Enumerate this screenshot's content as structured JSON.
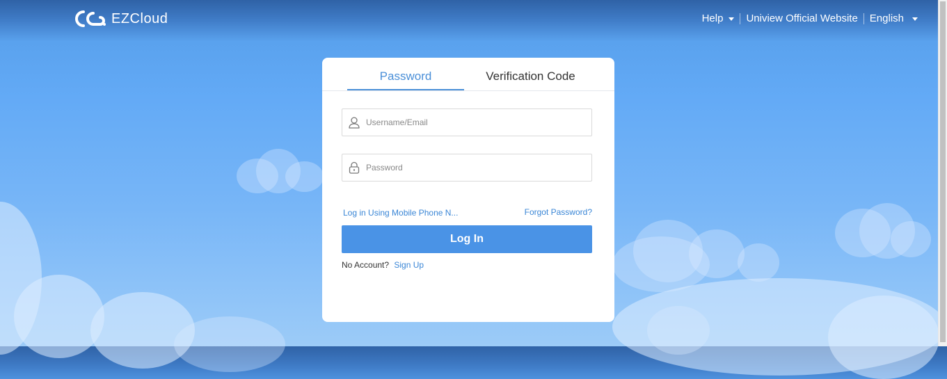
{
  "header": {
    "logo_text": "EZCloud",
    "nav": {
      "help": "Help",
      "official_site": "Uniview Official Website",
      "language": "English"
    }
  },
  "login": {
    "tabs": {
      "password": "Password",
      "verification_code": "Verification Code",
      "active": "Password"
    },
    "username": {
      "placeholder": "Username/Email",
      "value": ""
    },
    "password": {
      "placeholder": "Password",
      "value": ""
    },
    "mobile_login_link": "Log in Using Mobile Phone N...",
    "forgot_password_link": "Forgot Password?",
    "login_button": "Log In",
    "no_account_text": "No Account?",
    "signup_link": "Sign Up"
  },
  "colors": {
    "accent": "#4a93e6",
    "link": "#3a86d6",
    "tab_active": "#4a8fd8"
  },
  "icons": {
    "logo": "ezcloud-logo-icon",
    "help_caret": "chevron-down-icon",
    "language_caret": "chevron-down-icon",
    "username": "user-icon",
    "password": "lock-icon"
  }
}
